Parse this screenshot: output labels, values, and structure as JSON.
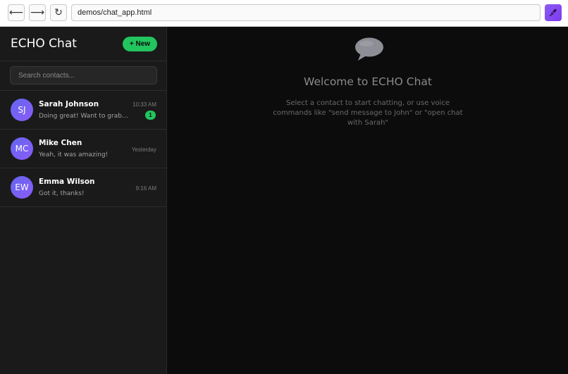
{
  "browser": {
    "back_icon": "arrow-left-icon",
    "back_glyph": "⟵",
    "forward_icon": "arrow-right-icon",
    "forward_glyph": "⟶",
    "reload_icon": "reload-icon",
    "reload_glyph": "↻",
    "url": "demos/chat_app.html",
    "mic_icon": "microphone-icon",
    "mic_color": "#8b5cf6"
  },
  "sidebar": {
    "title": "ECHO Chat",
    "new_button": "+ New",
    "new_button_color": "#22c55e",
    "search_placeholder": "Search contacts...",
    "search_value": "",
    "contacts": [
      {
        "initials": "SJ",
        "name": "Sarah Johnson",
        "preview": "Doing great! Want to grab c...",
        "time": "10:33 AM",
        "unread": "1"
      },
      {
        "initials": "MC",
        "name": "Mike Chen",
        "preview": "Yeah, it was amazing!",
        "time": "Yesterday"
      },
      {
        "initials": "EW",
        "name": "Emma Wilson",
        "preview": "Got it, thanks!",
        "time": "9:16 AM"
      }
    ]
  },
  "main": {
    "icon": "speech-bubble-icon",
    "welcome_title": "Welcome to ECHO Chat",
    "welcome_text": "Select a contact to start chatting, or use voice commands like \"send message to John\" or \"open chat with Sarah\""
  }
}
